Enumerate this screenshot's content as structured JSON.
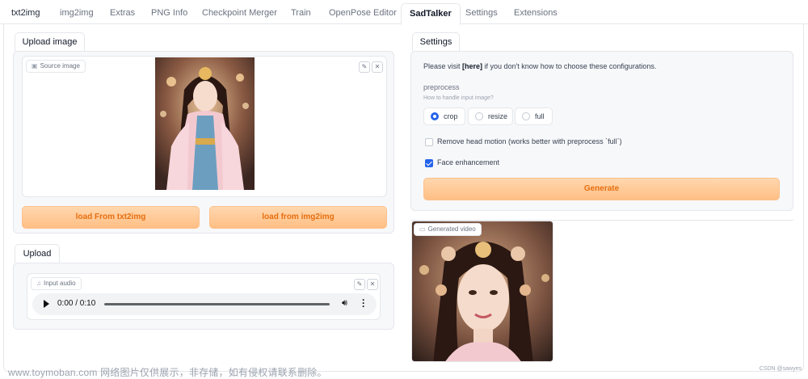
{
  "tabs": [
    "txt2img",
    "img2img",
    "Extras",
    "PNG Info",
    "Checkpoint Merger",
    "Train",
    "OpenPose Editor",
    "SadTalker",
    "Settings",
    "Extensions"
  ],
  "active_tab": "SadTalker",
  "upload_image": {
    "tab_label": "Upload image",
    "source_label": "Source image",
    "load_txt2img": "load From txt2img",
    "load_img2img": "load from img2img"
  },
  "upload": {
    "tab_label": "Upload",
    "audio_label": "Input audio",
    "time": "0:00 / 0:10"
  },
  "settings": {
    "tab_label": "Settings",
    "visit_prefix": "Please visit ",
    "visit_link": "[here]",
    "visit_suffix": " if you don't know how to choose these configurations.",
    "preprocess_label": "preprocess",
    "preprocess_info": "How to handle input image?",
    "options": [
      "crop",
      "resize",
      "full"
    ],
    "selected": "crop",
    "head_motion_label": "Remove head motion (works better with preprocess `full`)",
    "head_motion_checked": false,
    "face_enhancement_label": "Face enhancement",
    "face_enhancement_checked": true,
    "generate_label": "Generate"
  },
  "generated_video_label": "Generated video",
  "footer": {
    "watermark": "www.toymoban.com 网络图片仅供展示，非存储，如有侵权请联系删除。",
    "credit": "CSDN @sawyes"
  },
  "colors": {
    "accent_blue": "#2563eb",
    "orange_text": "#e56f10",
    "orange_bg": "#ffc890"
  }
}
